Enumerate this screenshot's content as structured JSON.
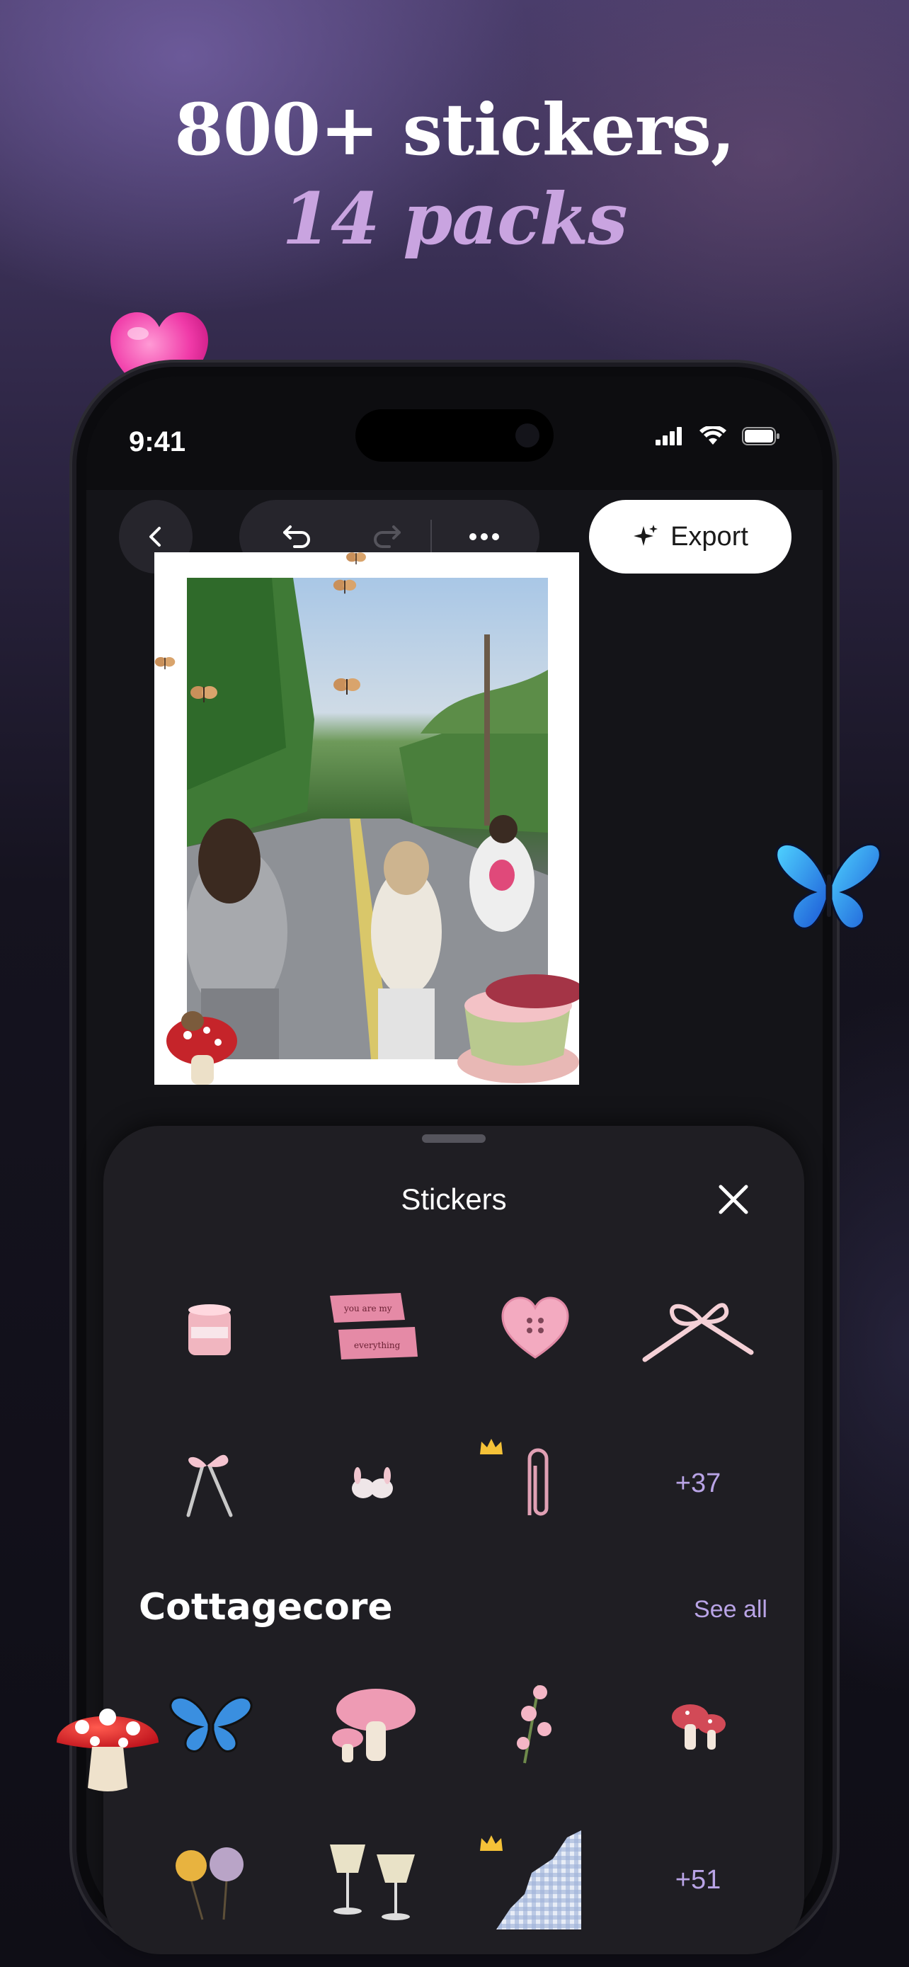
{
  "headline": {
    "line1": "800+ stickers,",
    "line2": "14 packs"
  },
  "status_bar": {
    "time": "9:41"
  },
  "toolbar": {
    "export_label": "Export"
  },
  "sheet": {
    "title": "Stickers",
    "row1_more": "+37",
    "section_title": "Cottagecore",
    "see_all": "See all",
    "row2_more": "+51",
    "tape_text_1": "you are my",
    "tape_text_2": "everything"
  },
  "colors": {
    "accent": "#b9a4e6",
    "headline_accent": "#c9a4e0",
    "sheet_bg": "#1f1e23",
    "crown": "#f5c238"
  }
}
